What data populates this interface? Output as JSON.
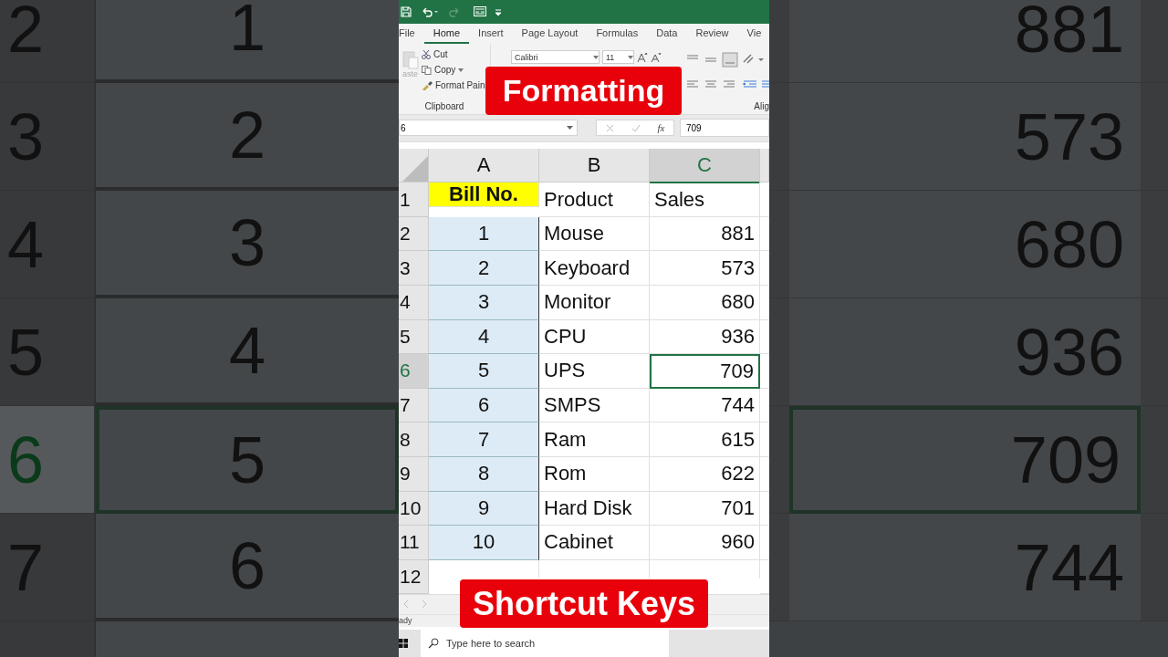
{
  "backdrop_left": {
    "rows": [
      {
        "number": "2",
        "value": "1",
        "selected": false
      },
      {
        "number": "3",
        "value": "2",
        "selected": false
      },
      {
        "number": "4",
        "value": "3",
        "selected": false
      },
      {
        "number": "5",
        "value": "4",
        "selected": false
      },
      {
        "number": "6",
        "value": "5",
        "selected": true
      },
      {
        "number": "7",
        "value": "6",
        "selected": false
      }
    ]
  },
  "backdrop_right": {
    "rows": [
      {
        "value": "881",
        "selected": false
      },
      {
        "value": "573",
        "selected": false
      },
      {
        "value": "680",
        "selected": false
      },
      {
        "value": "936",
        "selected": false
      },
      {
        "value": "709",
        "selected": true
      },
      {
        "value": "744",
        "selected": false
      }
    ]
  },
  "ribbon": {
    "tabs": [
      {
        "label": "File",
        "selected": false
      },
      {
        "label": "Home",
        "selected": true
      },
      {
        "label": "Insert",
        "selected": false
      },
      {
        "label": "Page Layout",
        "selected": false
      },
      {
        "label": "Formulas",
        "selected": false
      },
      {
        "label": "Data",
        "selected": false
      },
      {
        "label": "Review",
        "selected": false
      },
      {
        "label": "Vie",
        "selected": false
      }
    ],
    "paste": "aste",
    "cut": "Cut",
    "copy": "Copy",
    "format_painter": "Format Pain",
    "clipboard_label": "Clipboard",
    "font_name": "Calibri",
    "font_size": "11",
    "alignment_label": "Alig"
  },
  "formula_bar": {
    "name_box": "6",
    "function_button": "fx",
    "formula": "709"
  },
  "sheet": {
    "columns": [
      {
        "label": "A",
        "selected": false
      },
      {
        "label": "B",
        "selected": false
      },
      {
        "label": "C",
        "selected": true
      }
    ],
    "rows": [
      {
        "number": "1",
        "selected": false,
        "cells": [
          {
            "text": "Bill No.",
            "kind": "title",
            "selected": false
          },
          {
            "text": "Product",
            "kind": "text",
            "selected": false
          },
          {
            "text": "Sales",
            "kind": "text",
            "selected": false
          }
        ]
      },
      {
        "number": "2",
        "selected": false,
        "cells": [
          {
            "text": "1",
            "kind": "shaded",
            "selected": false
          },
          {
            "text": "Mouse",
            "kind": "text",
            "selected": false
          },
          {
            "text": "881",
            "kind": "number",
            "selected": false
          }
        ]
      },
      {
        "number": "3",
        "selected": false,
        "cells": [
          {
            "text": "2",
            "kind": "shaded",
            "selected": false
          },
          {
            "text": "Keyboard",
            "kind": "text",
            "selected": false
          },
          {
            "text": "573",
            "kind": "number",
            "selected": false
          }
        ]
      },
      {
        "number": "4",
        "selected": false,
        "cells": [
          {
            "text": "3",
            "kind": "shaded",
            "selected": false
          },
          {
            "text": "Monitor",
            "kind": "text",
            "selected": false
          },
          {
            "text": "680",
            "kind": "number",
            "selected": false
          }
        ]
      },
      {
        "number": "5",
        "selected": false,
        "cells": [
          {
            "text": "4",
            "kind": "shaded",
            "selected": false
          },
          {
            "text": "CPU",
            "kind": "text",
            "selected": false
          },
          {
            "text": "936",
            "kind": "number",
            "selected": false
          }
        ]
      },
      {
        "number": "6",
        "selected": true,
        "cells": [
          {
            "text": "5",
            "kind": "shaded",
            "selected": false
          },
          {
            "text": "UPS",
            "kind": "text",
            "selected": false
          },
          {
            "text": "709",
            "kind": "number",
            "selected": true
          }
        ]
      },
      {
        "number": "7",
        "selected": false,
        "cells": [
          {
            "text": "6",
            "kind": "shaded",
            "selected": false
          },
          {
            "text": "SMPS",
            "kind": "text",
            "selected": false
          },
          {
            "text": "744",
            "kind": "number",
            "selected": false
          }
        ]
      },
      {
        "number": "8",
        "selected": false,
        "cells": [
          {
            "text": "7",
            "kind": "shaded",
            "selected": false
          },
          {
            "text": "Ram",
            "kind": "text",
            "selected": false
          },
          {
            "text": "615",
            "kind": "number",
            "selected": false
          }
        ]
      },
      {
        "number": "9",
        "selected": false,
        "cells": [
          {
            "text": "8",
            "kind": "shaded",
            "selected": false
          },
          {
            "text": "Rom",
            "kind": "text",
            "selected": false
          },
          {
            "text": "622",
            "kind": "number",
            "selected": false
          }
        ]
      },
      {
        "number": "10",
        "selected": false,
        "cells": [
          {
            "text": "9",
            "kind": "shaded",
            "selected": false
          },
          {
            "text": "Hard Disk",
            "kind": "text",
            "selected": false
          },
          {
            "text": "701",
            "kind": "number",
            "selected": false
          }
        ]
      },
      {
        "number": "11",
        "selected": false,
        "cells": [
          {
            "text": "10",
            "kind": "shaded",
            "selected": false
          },
          {
            "text": "Cabinet",
            "kind": "text",
            "selected": false
          },
          {
            "text": "960",
            "kind": "number",
            "selected": false
          }
        ]
      },
      {
        "number": "12",
        "selected": false,
        "cells": []
      }
    ]
  },
  "status_bar": {
    "text": "ady"
  },
  "taskbar": {
    "search_placeholder": "Type here to search"
  },
  "captions": {
    "top": "Formatting",
    "bottom": "Shortcut Keys"
  }
}
